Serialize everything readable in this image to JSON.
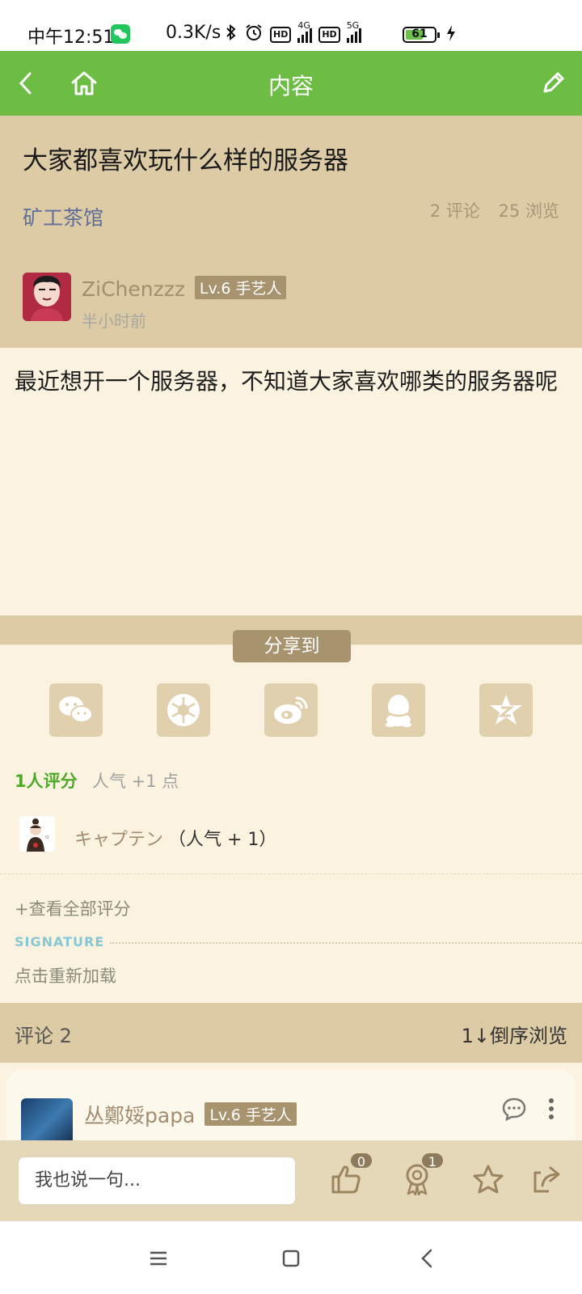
{
  "status_bar": {
    "time": "中午12:51",
    "net_speed": "0.3K/s",
    "network_1": "4G",
    "network_2": "5G",
    "hd_label": "HD",
    "battery_percent": 61,
    "battery_text": "61"
  },
  "header": {
    "title": "内容"
  },
  "post": {
    "title": "大家都喜欢玩什么样的服务器",
    "forum": "矿工茶馆",
    "comments_stat": "2 评论",
    "views_stat": "25 浏览",
    "author": {
      "name": "ZiChenzzz",
      "level": "Lv.6 手艺人",
      "time": "半小时前"
    },
    "body": "最近想开一个服务器，不知道大家喜欢哪类的服务器呢"
  },
  "share": {
    "label": "分享到",
    "targets": [
      "wechat-icon",
      "moments-icon",
      "weibo-icon",
      "qq-icon",
      "qzone-icon"
    ]
  },
  "rating": {
    "count_label": "1人评分",
    "popularity": "人气 +1 点",
    "rater_name": "キャプテン",
    "rater_points": "（人气 + 1）",
    "view_all": "+查看全部评分"
  },
  "signature": {
    "label": "SIGNATURE",
    "reload": "点击重新加载"
  },
  "comments": {
    "count_label": "评论 2",
    "sort_label": "1↓倒序浏览",
    "first": {
      "name": "丛鄭娞papa",
      "level": "Lv.6 手艺人"
    }
  },
  "bottom_bar": {
    "placeholder": "我也说一句...",
    "like_count": "0",
    "rate_count": "1"
  },
  "colors": {
    "header_green": "#6dbd45",
    "tan": "#dccba4",
    "cream": "#fbf3df",
    "badge_brown": "#a8936f"
  }
}
